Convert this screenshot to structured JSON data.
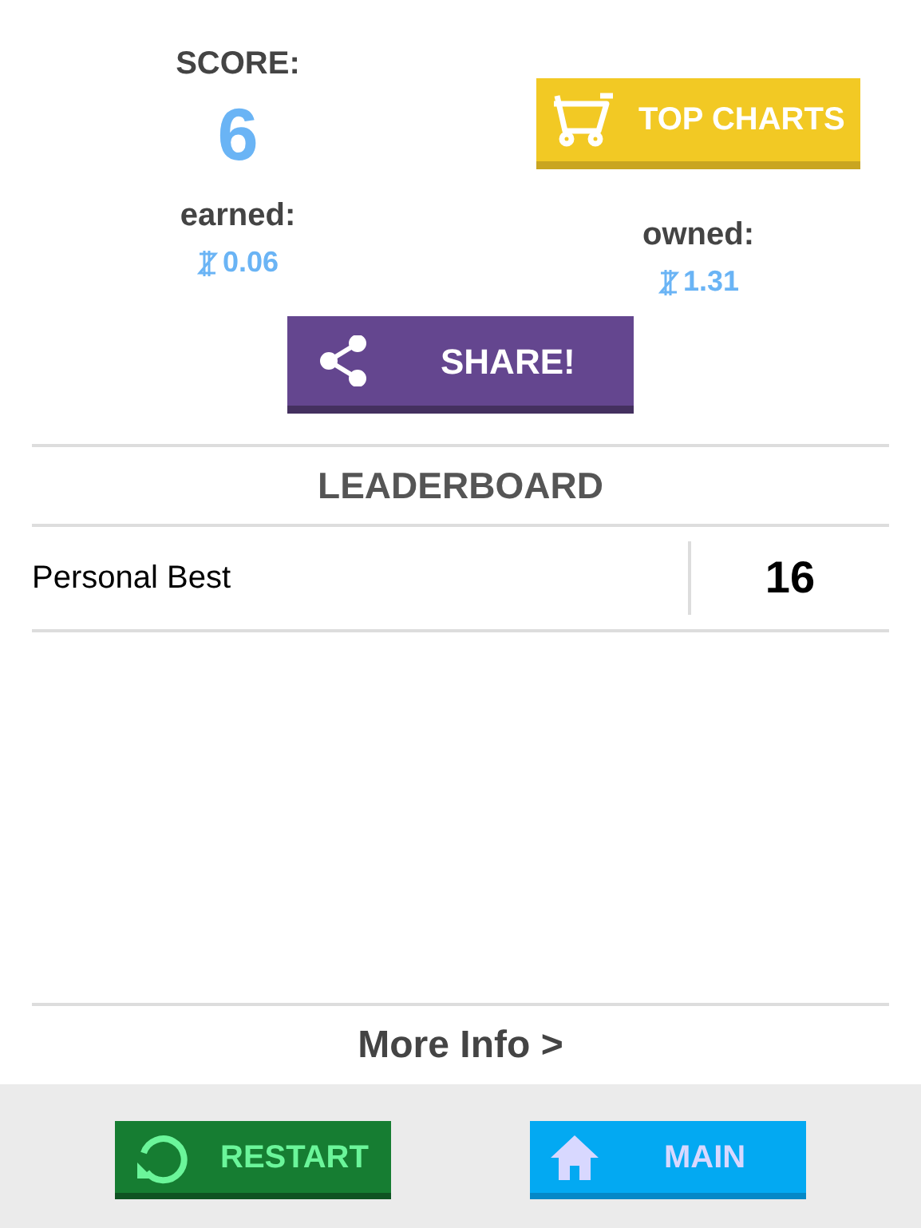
{
  "score": {
    "label": "SCORE:",
    "value": "6"
  },
  "top_charts_button": {
    "label": "TOP CHARTS"
  },
  "earned": {
    "label": "earned:",
    "amount": "0.06"
  },
  "owned": {
    "label": "owned:",
    "amount": "1.31"
  },
  "share_button": {
    "label": "SHARE!"
  },
  "leaderboard": {
    "title": "LEADERBOARD",
    "rows": [
      {
        "name": "Personal Best",
        "value": "16"
      }
    ]
  },
  "more_info": "More Info >",
  "footer_buttons": [
    {
      "kind": "restart",
      "label": "RESTART"
    },
    {
      "kind": "main",
      "label": "MAIN"
    }
  ]
}
